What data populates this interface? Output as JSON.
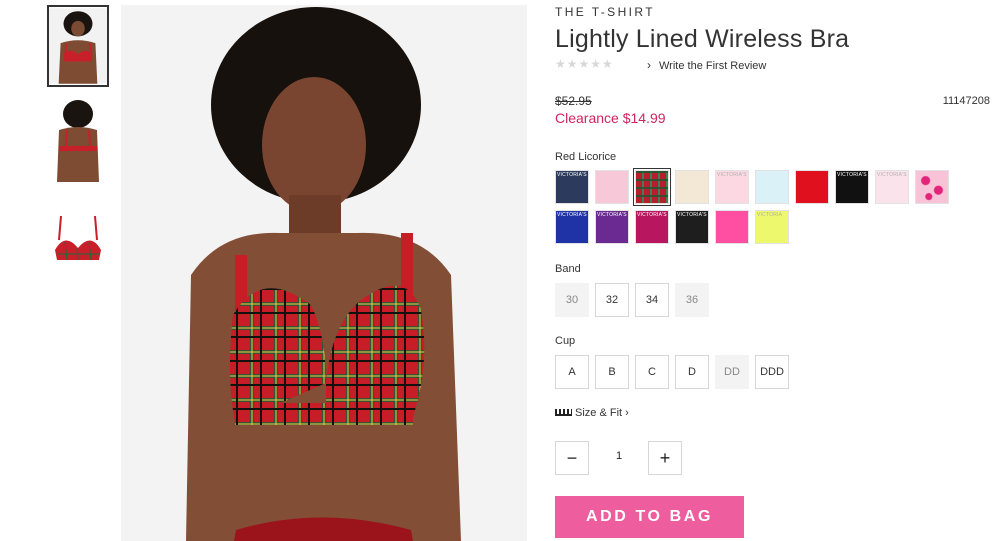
{
  "product": {
    "collection": "THE T-SHIRT",
    "title": "Lightly Lined Wireless Bra",
    "stars": "★★★★★",
    "review_link": "Write the First Review",
    "review_chevron": "›",
    "original_price": "$52.95",
    "sale_price": "Clearance $14.99",
    "sku": "11147208"
  },
  "color": {
    "label": "Red Licorice",
    "swatches": [
      {
        "name": "navy-gold-logo",
        "color": "#2c3a5e",
        "text": "VICTORIA'S"
      },
      {
        "name": "pink-script",
        "color": "#f6c8d8",
        "text": ""
      },
      {
        "name": "red-licorice-plaid",
        "color": "#b51f2a",
        "text": ""
      },
      {
        "name": "cream-print",
        "color": "#f3e7d6",
        "text": ""
      },
      {
        "name": "light-pink-logo",
        "color": "#fcd8e2",
        "text": "VICTORIA'S"
      },
      {
        "name": "light-blue",
        "color": "#d9f1f7",
        "text": ""
      },
      {
        "name": "red",
        "color": "#e0101e",
        "text": ""
      },
      {
        "name": "black-logo",
        "color": "#111111",
        "text": "VICTORIA'S"
      },
      {
        "name": "pale-pink-logo",
        "color": "#fbe3ec",
        "text": "VICTORIA'S"
      },
      {
        "name": "pink-lips",
        "color": "#f8b6cf",
        "text": ""
      },
      {
        "name": "royal-blue-logo",
        "color": "#1f33a6",
        "text": "VICTORIA'S"
      },
      {
        "name": "purple",
        "color": "#6b2a91",
        "text": "VICTORIA'S"
      },
      {
        "name": "berry",
        "color": "#b8165e",
        "text": "VICTORIA'S"
      },
      {
        "name": "black",
        "color": "#1e1e1e",
        "text": "VICTORIA'S SECRET"
      },
      {
        "name": "hot-pink",
        "color": "#ff4fa3",
        "text": ""
      },
      {
        "name": "lime",
        "color": "#eef86d",
        "text": "VICTORIA"
      }
    ],
    "selected_index": 2
  },
  "band": {
    "label": "Band",
    "sizes": [
      {
        "label": "30",
        "disabled": true
      },
      {
        "label": "32",
        "disabled": false
      },
      {
        "label": "34",
        "disabled": false
      },
      {
        "label": "36",
        "disabled": true
      }
    ]
  },
  "cup": {
    "label": "Cup",
    "sizes": [
      {
        "label": "A",
        "disabled": false
      },
      {
        "label": "B",
        "disabled": false
      },
      {
        "label": "C",
        "disabled": false
      },
      {
        "label": "D",
        "disabled": false
      },
      {
        "label": "DD",
        "disabled": true
      },
      {
        "label": "DDD",
        "disabled": false
      }
    ]
  },
  "size_fit": {
    "label": "Size & Fit",
    "chevron": "›"
  },
  "quantity": {
    "minus": "−",
    "value": "1",
    "plus": "+"
  },
  "add_to_bag": "ADD TO BAG",
  "icons": [
    "star-icon",
    "chevron-right-icon",
    "ruler-icon",
    "minus-icon",
    "plus-icon"
  ]
}
